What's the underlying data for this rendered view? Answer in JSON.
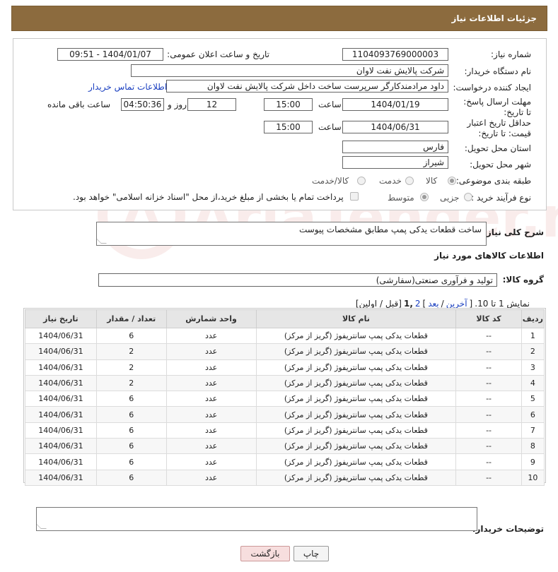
{
  "header": {
    "title": "جزئیات اطلاعات نیاز"
  },
  "form": {
    "need_number": {
      "label": "شماره نیاز:",
      "value": "1104093769000003"
    },
    "announce": {
      "label": "تاریخ و ساعت اعلان عمومی:",
      "value": "1404/01/07 - 09:51"
    },
    "buyer_org": {
      "label": "نام دستگاه خریدار:",
      "value": "شرکت پالایش نفت لاوان"
    },
    "requester": {
      "label": "ایجاد کننده درخواست:",
      "value": "داود مرادمندکارگر سرپرست ساخت داخل شرکت پالایش نفت لاوان"
    },
    "contact_link": "اطلاعات تماس خریدار",
    "reply_deadline": {
      "label": "مهلت ارسال پاسخ: تا تاریخ:",
      "date": "1404/01/19",
      "time_label": "ساعت",
      "time": "15:00",
      "days": "12",
      "days_label": "روز و",
      "remaining": "04:50:36",
      "remaining_label": "ساعت باقی مانده"
    },
    "price_validity": {
      "label": "حداقل تاریخ اعتبار قیمت: تا تاریخ:",
      "date": "1404/06/31",
      "time_label": "ساعت",
      "time": "15:00"
    },
    "province": {
      "label": "استان محل تحویل:",
      "value": "فارس"
    },
    "city": {
      "label": "شهر محل تحویل:",
      "value": "شیراز"
    },
    "category": {
      "label": "طبقه بندی موضوعی:",
      "options": [
        "کالا",
        "خدمت",
        "کالا/خدمت"
      ]
    },
    "process": {
      "label": "نوع فرآیند خرید :",
      "options": [
        "جزیی",
        "متوسط"
      ],
      "note": "پرداخت تمام یا بخشی از مبلغ خرید،از محل \"اسناد خزانه اسلامی\" خواهد بود."
    }
  },
  "summary": {
    "label": "شرح کلی نیاز:",
    "value": "ساخت قطعات یدکی پمپ مطابق مشخصات پیوست"
  },
  "goods_section_title": "اطلاعات کالاهای مورد نیاز",
  "goods_group": {
    "label": "گروه کالا:",
    "value": "تولید و فرآوری صنعتی(سفارشی)"
  },
  "pagination": {
    "prefix": "نمایش 1 تا 10.",
    "open": "[",
    "last": "آخرین",
    "sep1": "/",
    "next": "بعد",
    "close": "]",
    "page2": "2",
    "page1": ",1",
    "tail": "[قبل / اولین]"
  },
  "table": {
    "headers": [
      "ردیف",
      "کد کالا",
      "نام کالا",
      "واحد شمارش",
      "تعداد / مقدار",
      "تاریخ نیاز"
    ],
    "rows": [
      [
        "1",
        "--",
        "قطعات یدکی پمپ سانتریفوژ (گریز از مرکز)",
        "عدد",
        "6",
        "1404/06/31"
      ],
      [
        "2",
        "--",
        "قطعات یدکی پمپ سانتریفوژ (گریز از مرکز)",
        "عدد",
        "2",
        "1404/06/31"
      ],
      [
        "3",
        "--",
        "قطعات یدکی پمپ سانتریفوژ (گریز از مرکز)",
        "عدد",
        "2",
        "1404/06/31"
      ],
      [
        "4",
        "--",
        "قطعات یدکی پمپ سانتریفوژ (گریز از مرکز)",
        "عدد",
        "2",
        "1404/06/31"
      ],
      [
        "5",
        "--",
        "قطعات یدکی پمپ سانتریفوژ (گریز از مرکز)",
        "عدد",
        "6",
        "1404/06/31"
      ],
      [
        "6",
        "--",
        "قطعات یدکی پمپ سانتریفوژ (گریز از مرکز)",
        "عدد",
        "6",
        "1404/06/31"
      ],
      [
        "7",
        "--",
        "قطعات یدکی پمپ سانتریفوژ (گریز از مرکز)",
        "عدد",
        "6",
        "1404/06/31"
      ],
      [
        "8",
        "--",
        "قطعات یدکی پمپ سانتریفوژ (گریز از مرکز)",
        "عدد",
        "6",
        "1404/06/31"
      ],
      [
        "9",
        "--",
        "قطعات یدکی پمپ سانتریفوژ (گریز از مرکز)",
        "عدد",
        "6",
        "1404/06/31"
      ],
      [
        "10",
        "--",
        "قطعات یدکی پمپ سانتریفوژ (گریز از مرکز)",
        "عدد",
        "6",
        "1404/06/31"
      ]
    ]
  },
  "buyer_notes": {
    "label": "توضیحات خریدار:",
    "value": ""
  },
  "buttons": {
    "print": "چاپ",
    "back": "بازگشت"
  },
  "watermark": {
    "text": "AriaTender.neT"
  }
}
